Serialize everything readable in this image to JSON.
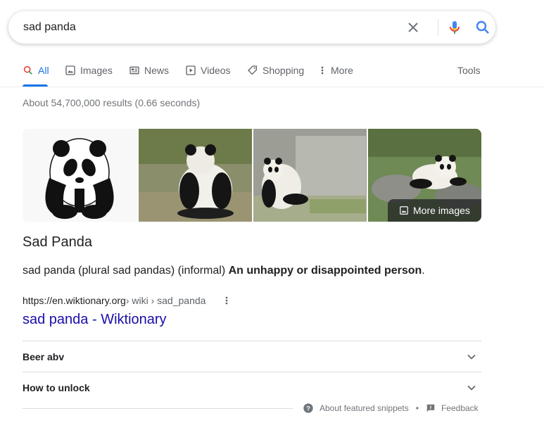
{
  "search": {
    "query": "sad panda"
  },
  "tabs": [
    {
      "label": "All",
      "icon": "search-icon"
    },
    {
      "label": "Images",
      "icon": "image-icon"
    },
    {
      "label": "News",
      "icon": "news-icon"
    },
    {
      "label": "Videos",
      "icon": "play-icon"
    },
    {
      "label": "Shopping",
      "icon": "tag-icon"
    },
    {
      "label": "More",
      "icon": "kebab-icon"
    }
  ],
  "tools_label": "Tools",
  "result_stats": "About 54,700,000 results (0.66 seconds)",
  "images": {
    "more_label": "More images"
  },
  "snippet": {
    "title": "Sad Panda",
    "definition_prefix": "sad panda (plural sad pandas) (informal)",
    "definition_bold": "An unhappy or disappointed person",
    "definition_suffix": ".",
    "cite_domain": "https://en.wiktionary.org",
    "cite_path": " › wiki › sad_panda",
    "link_text": "sad panda - Wiktionary"
  },
  "related_questions": [
    {
      "label": "Beer abv"
    },
    {
      "label": "How to unlock"
    }
  ],
  "footer": {
    "about_label": "About featured snippets",
    "separator": "•",
    "feedback_label": "Feedback"
  },
  "colors": {
    "accent": "#1a73e8",
    "link": "#1a0dab",
    "text": "#202124",
    "muted": "#70757a"
  }
}
